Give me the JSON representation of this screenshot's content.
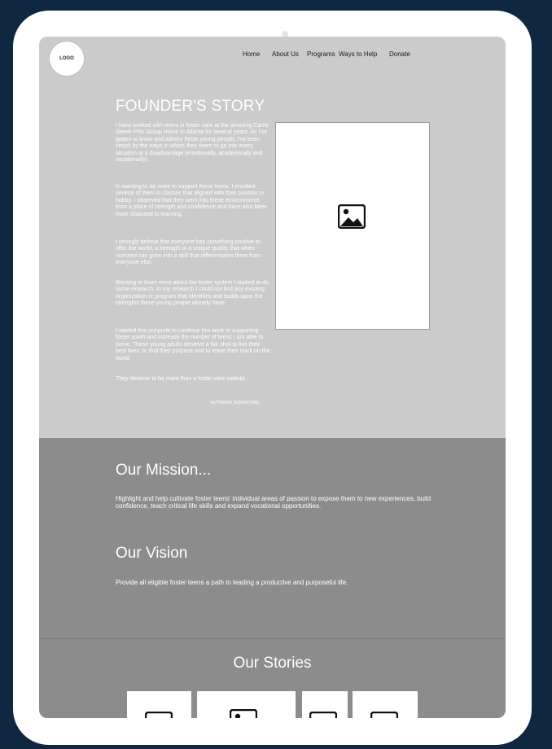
{
  "header": {
    "logo": "LOGO",
    "nav": [
      "Home",
      "About Us",
      "Programs",
      "Ways to Help",
      "Donate"
    ]
  },
  "founder": {
    "title": "FOUNDER'S STORY",
    "paragraphs": [
      "I have worked with teens in foster care at the amazing Carrie Steele Pitts Group Home in Atlanta for several years. As I've gotten to know and admire these young people, I've been struck by the ways in which they seem to go into every situation at a disadvantage (emotionally, academically and vocationally).",
      "In wanting to do more to support these teens, I enrolled several of them in classes that aligned with their passion or hobby. I observed that they went into these environments from a place of strength and confidence and have also been more disposed to learning.",
      "I strongly believe that everyone has something positive to offer the world, a strength or a unique quality that when nurtured can grow into a skill that differentiates them from everyone else.",
      "Wanting to learn more about the foster system I started to do some research. In my research I could not find any existing organization or program that identifies and builds upon the strengths these young people already have.",
      "I started this nonprofit to continue this work of supporting foster youth and increase the number of teens I am able to serve. These young adults deserve a fair shot to live their best lives, to find their purpose and to leave their mark on the world.",
      "They deserve to be more than a foster care statistic."
    ],
    "signature": "AUTHORS SIGNATURE",
    "image_icon": "image-placeholder-icon"
  },
  "mission": {
    "title": "Our Mission...",
    "text": "Highlight and help cultivate foster teens' individual areas of passion to expose them to new experiences, build confidence, teach critical life skills and expand vocational opportunities."
  },
  "vision": {
    "title": "Our Vision",
    "text": "Provide all eligible foster teens a path to leading a productive and purposeful life."
  },
  "stories": {
    "title": "Our Stories",
    "cards": [
      "story-image-icon",
      "story-image-icon",
      "story-image-icon",
      "story-image-icon"
    ]
  },
  "colors": {
    "background": "#0f2740",
    "device": "#ffffff",
    "founder_bg": "#cbcbcb",
    "section_bg": "#8c8c8c",
    "text_light": "#ffffff"
  }
}
